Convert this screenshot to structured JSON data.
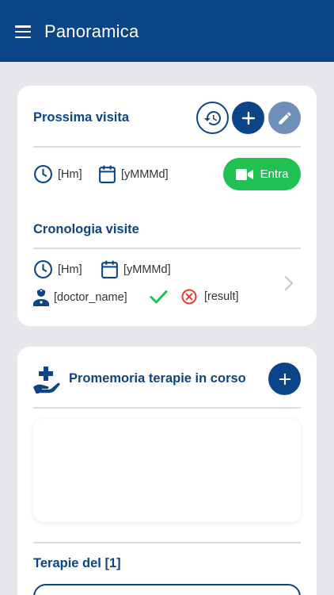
{
  "appbar": {
    "title": "Panoramica",
    "menu_icon": "hamburger-icon"
  },
  "next_visit": {
    "title": "Prossima visita",
    "time": "[Hm]",
    "date": "[yMMMd]",
    "join_label": "Entra"
  },
  "history": {
    "title": "Cronologia visite",
    "time": "[Hm]",
    "date": "[yMMMd]",
    "doctor": "[doctor_name]",
    "result": "[result]"
  },
  "therapy": {
    "title": "Promemoria terapie in corso",
    "day_title": "Terapie del [1]"
  },
  "colors": {
    "primary": "#0b4587",
    "success": "#20c153",
    "error": "#e53935",
    "edit_button": "#6e8fb8",
    "background": "#e5e7eb"
  }
}
